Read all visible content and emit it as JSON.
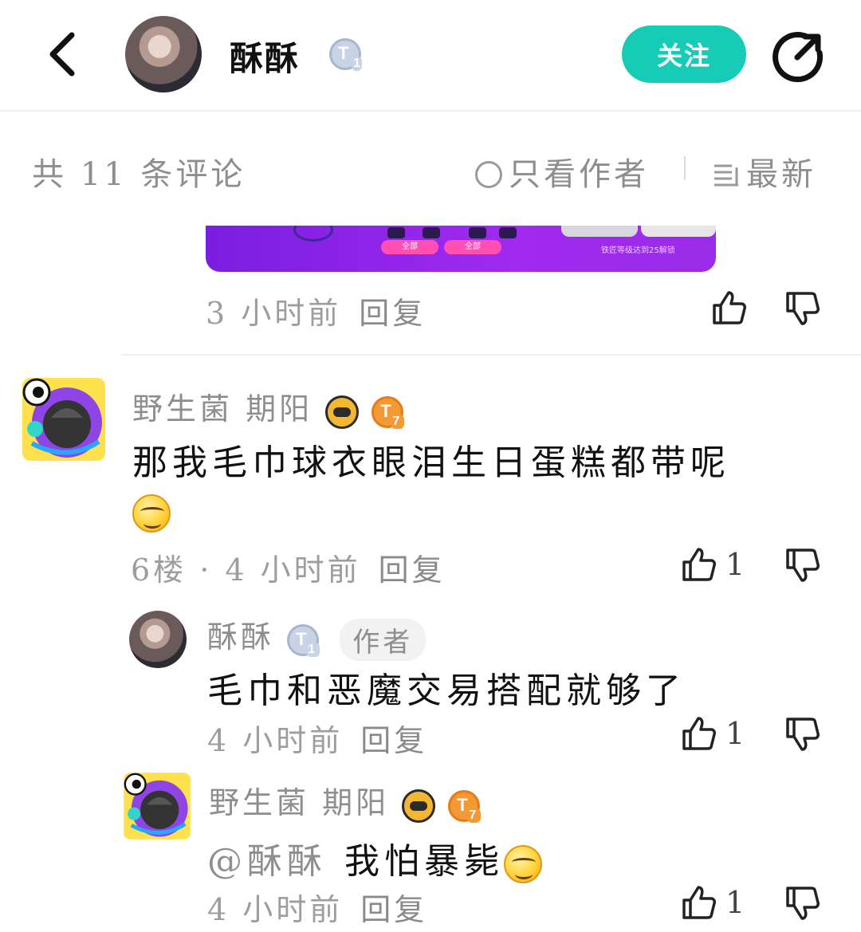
{
  "header": {
    "author_name": "酥酥",
    "author_level": "1",
    "follow_label": "关注"
  },
  "subbar": {
    "count_label": "共 11 条评论",
    "author_only_label": "只看作者",
    "sort_label": "最新"
  },
  "image_card": {
    "tags": [
      "全部",
      "全部"
    ],
    "locked_text": "铁匠等级达到25解锁"
  },
  "comments": [
    {
      "time": "3 小时前",
      "reply_label": "回复",
      "likes": ""
    },
    {
      "user": "野生菌 期阳",
      "level": "7",
      "text": "那我毛巾球衣眼泪生日蛋糕都带呢",
      "floor_time": "6楼 · 4 小时前",
      "reply_label": "回复",
      "likes": "1"
    },
    {
      "user": "酥酥",
      "level": "1",
      "author_tag": "作者",
      "text": "毛巾和恶魔交易搭配就够了",
      "time": "4 小时前",
      "reply_label": "回复",
      "likes": "1"
    },
    {
      "user": "野生菌 期阳",
      "level": "7",
      "mention": "@酥酥",
      "text": "我怕暴毙",
      "time": "4 小时前",
      "reply_label": "回复",
      "likes": "1"
    }
  ],
  "colors": {
    "accent": "#17ccb7",
    "text_secondary": "#8e8e8e"
  },
  "icons": [
    "back-arrow-icon",
    "share-icon",
    "thumbs-up-icon",
    "thumbs-down-icon",
    "sort-lines-icon",
    "circle-radio-icon",
    "emoji-smile-icon",
    "gamepad-badge-icon",
    "level-badge-icon"
  ]
}
